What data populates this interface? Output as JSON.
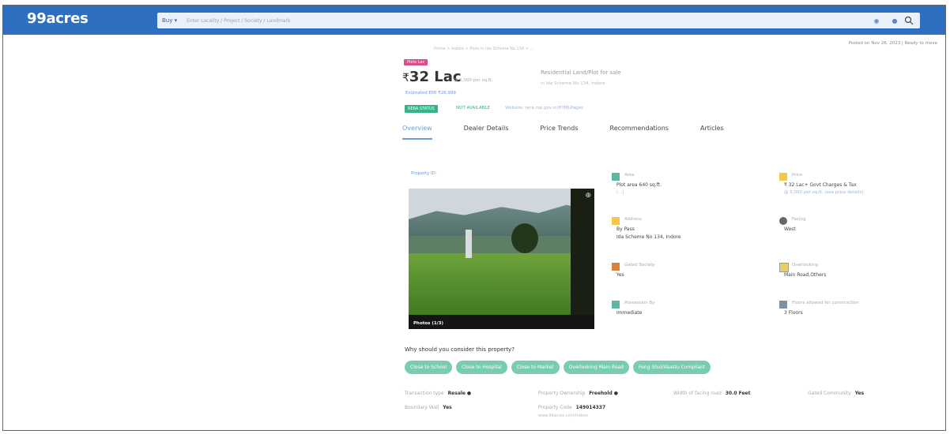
{
  "header": {
    "logo": "99acres",
    "buy_label": "Buy ▾",
    "search_placeholder": "Enter Locality / Project / Society / Landmark"
  },
  "posted": "Posted on Nov 26, 2023  |  Ready to move",
  "breadcrumb": "Home > Indore > Plots in Ida Scheme No 134 > ...",
  "listing": {
    "badge": "Plots Lac",
    "price": "32 Lac",
    "price_sub": "@ 5,000 per sq.ft.",
    "estimated": "Estimated EMI ₹26,999",
    "property_type": "Residential Land/Plot for sale",
    "property_location": "in Ida Scheme No 134, Indore",
    "rera_badge": "RERA STATUS",
    "rera_status": "NOT AVAILABLE",
    "rera_link": "Website: rera.mp.gov.in/HTMLPages"
  },
  "tabs": [
    "Overview",
    "Dealer Details",
    "Price Trends",
    "Recommendations",
    "Articles"
  ],
  "photo": {
    "id_label": "Property ID:",
    "count_label": "Photos (1/3)"
  },
  "facts": [
    {
      "label": "Area",
      "value": "Plot area 640  sq.ft.",
      "value2": "",
      "value3": "(...)",
      "icon_color": "#5fb7a3"
    },
    {
      "label": "Price",
      "value": "₹ 32 Lac+ Govt Charges & Tax",
      "value2": "",
      "value3": "@ 5,000 per sq.ft. (see price details)",
      "icon_color": "#f2c94c"
    },
    {
      "label": "Address",
      "value": "By Pass",
      "value2": "Ida Scheme No 134, Indore",
      "value3": "",
      "icon_color": "#f2c94c"
    },
    {
      "label": "Facing",
      "value": "West",
      "value2": "",
      "value3": "",
      "icon_color": "#666666"
    },
    {
      "label": "Gated Society",
      "value": "Yes",
      "value2": "",
      "value3": "",
      "icon_color": "#d9823b"
    },
    {
      "label": "Overlooking",
      "value": "Main Road,Others",
      "value2": "",
      "value3": "",
      "icon_color": "#e9cf68"
    },
    {
      "label": "Possession By",
      "value": "Immediate",
      "value2": "",
      "value3": "",
      "icon_color": "#5fb7a3"
    },
    {
      "label": "Floors allowed for construction",
      "value": "3 Floors",
      "value2": "",
      "value3": "",
      "icon_color": "#7d8fa9"
    }
  ],
  "consider_title": "Why should you consider this property?",
  "pills": [
    "Close to School",
    "Close to Hospital",
    "Close to Market",
    "Overlooking Main Road",
    "Feng Shui/Vaastu Compliant"
  ],
  "bottom": {
    "transaction_label": "Transaction type",
    "transaction_value": "Resale",
    "ownership_label": "Property Ownership",
    "ownership_value": "Freehold",
    "road_label": "Width of facing road",
    "road_value": "30.0 Feet",
    "gated_label": "Gated Community",
    "gated_value": "Yes",
    "boundary_label": "Boundary Wall",
    "boundary_value": "Yes",
    "code_label": "Property Code",
    "code_value": "149014337",
    "code_sub": "www.99acres.com/Indore"
  }
}
